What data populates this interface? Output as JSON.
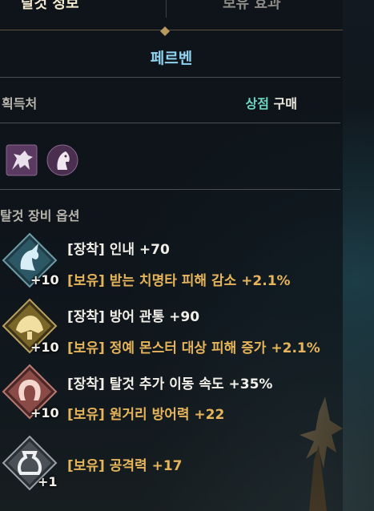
{
  "tabs": {
    "active": "탈것 정보",
    "inactive": "보유 효과"
  },
  "title": "페르벤",
  "source": {
    "label": "획득처",
    "shop": "상점",
    "buy": "구매"
  },
  "icons": [
    "mount-silhouette-icon",
    "horse-head-icon"
  ],
  "options": {
    "section_label": "탈것 장비 옵션",
    "items": [
      {
        "icon": "unicorn-icon",
        "level": "+10",
        "lines": [
          {
            "text": "[장착] 인내 +70",
            "color": "#f2efe8"
          },
          {
            "text": "[보유] 받는 치명타 피해 감소 +2.1%",
            "color": "#e6b45a"
          }
        ]
      },
      {
        "icon": "saddle-icon",
        "level": "+10",
        "lines": [
          {
            "text": "[장착] 방어 관통 +90",
            "color": "#f2efe8"
          },
          {
            "text": "[보유] 정예 몬스터 대상 피해 증가 +2.1%",
            "color": "#e6b45a"
          }
        ]
      },
      {
        "icon": "horseshoe-icon",
        "level": "+10",
        "lines": [
          {
            "text": "[장착] 탈것 추가 이동 속도 +35%",
            "color": "#f2efe8"
          },
          {
            "text": "[보유] 원거리 방어력 +22",
            "color": "#e6b45a"
          }
        ]
      },
      {
        "icon": "stirrup-icon",
        "level": "+1",
        "lines": [
          {
            "text": "[보유] 공격력 +17",
            "color": "#e6b45a"
          }
        ]
      }
    ]
  }
}
